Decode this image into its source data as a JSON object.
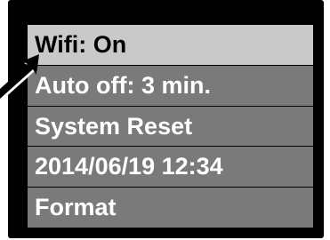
{
  "menu": {
    "items": [
      {
        "label": "Wifi: On",
        "selected": true
      },
      {
        "label": "Auto off: 3 min.",
        "selected": false
      },
      {
        "label": "System Reset",
        "selected": false
      },
      {
        "label": "2014/06/19 12:34",
        "selected": false
      },
      {
        "label": "Format",
        "selected": false
      }
    ]
  },
  "colors": {
    "frame": "#000000",
    "item_background": "#7a7a7a",
    "selected_background": "#c9c9c9",
    "item_text": "#ffffff",
    "selected_text": "#000000",
    "pointer": "#000000"
  },
  "pointer": {
    "icon": "arrow-pointer-icon"
  }
}
